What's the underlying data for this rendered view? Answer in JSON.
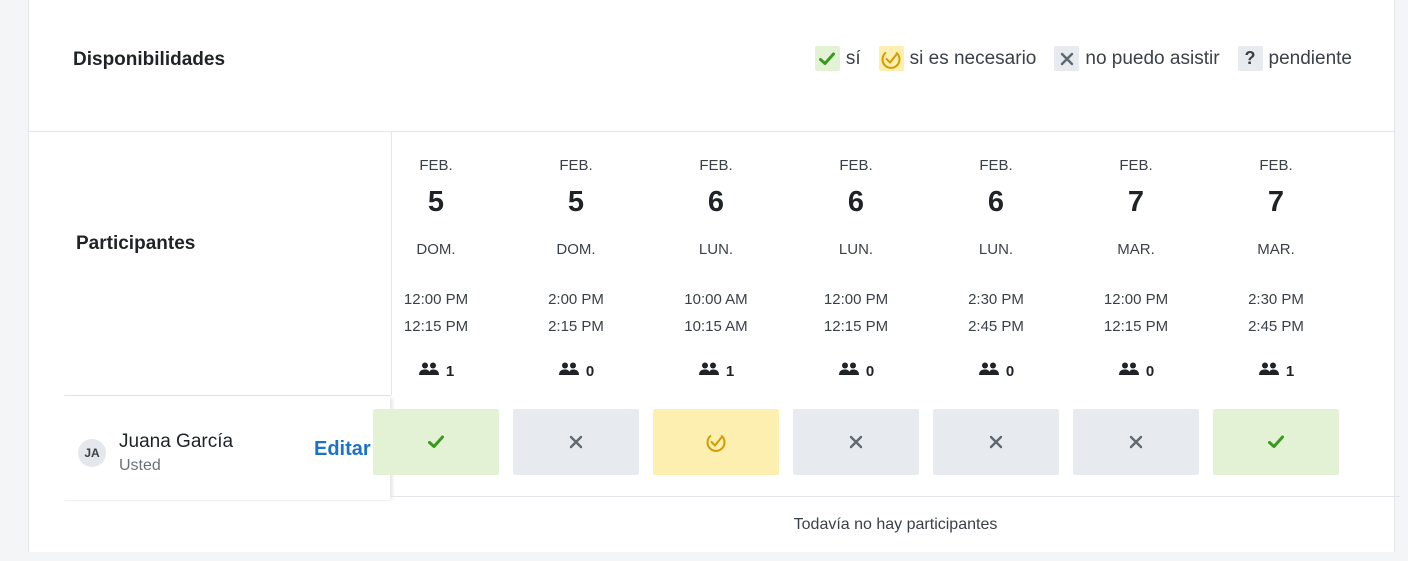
{
  "header": {
    "title": "Disponibilidades"
  },
  "legend": [
    {
      "label": "sí",
      "kind": "yes",
      "icon": "check-icon"
    },
    {
      "label": "si es necesario",
      "kind": "maybe",
      "icon": "circle-check-icon"
    },
    {
      "label": "no puedo asistir",
      "kind": "no",
      "icon": "x-icon"
    },
    {
      "label": "pendiente",
      "kind": "pending",
      "icon": "question-icon"
    }
  ],
  "participants_label": "Participantes",
  "slots": [
    {
      "month": "FEB.",
      "day": "5",
      "dow": "DOM.",
      "start": "12:00 PM",
      "end": "12:15 PM",
      "count": "1"
    },
    {
      "month": "FEB.",
      "day": "5",
      "dow": "DOM.",
      "start": "2:00 PM",
      "end": "2:15 PM",
      "count": "0"
    },
    {
      "month": "FEB.",
      "day": "6",
      "dow": "LUN.",
      "start": "10:00 AM",
      "end": "10:15 AM",
      "count": "1"
    },
    {
      "month": "FEB.",
      "day": "6",
      "dow": "LUN.",
      "start": "12:00 PM",
      "end": "12:15 PM",
      "count": "0"
    },
    {
      "month": "FEB.",
      "day": "6",
      "dow": "LUN.",
      "start": "2:30 PM",
      "end": "2:45 PM",
      "count": "0"
    },
    {
      "month": "FEB.",
      "day": "7",
      "dow": "MAR.",
      "start": "12:00 PM",
      "end": "12:15 PM",
      "count": "0"
    },
    {
      "month": "FEB.",
      "day": "7",
      "dow": "MAR.",
      "start": "2:30 PM",
      "end": "2:45 PM",
      "count": "1"
    }
  ],
  "participant": {
    "initials": "JA",
    "name": "Juana García",
    "subtitle": "Usted",
    "edit_label": "Editar",
    "responses": [
      "yes",
      "no",
      "maybe",
      "no",
      "no",
      "no",
      "yes"
    ]
  },
  "empty_message": "Todavía no hay participantes",
  "colors": {
    "yes": "#e3f2d5",
    "maybe": "#fcefb0",
    "no": "#e7eaee",
    "yes_icon": "#3a9a1e",
    "maybe_icon": "#d49b00",
    "no_icon": "#5f6770",
    "accent": "#1a73c8"
  }
}
